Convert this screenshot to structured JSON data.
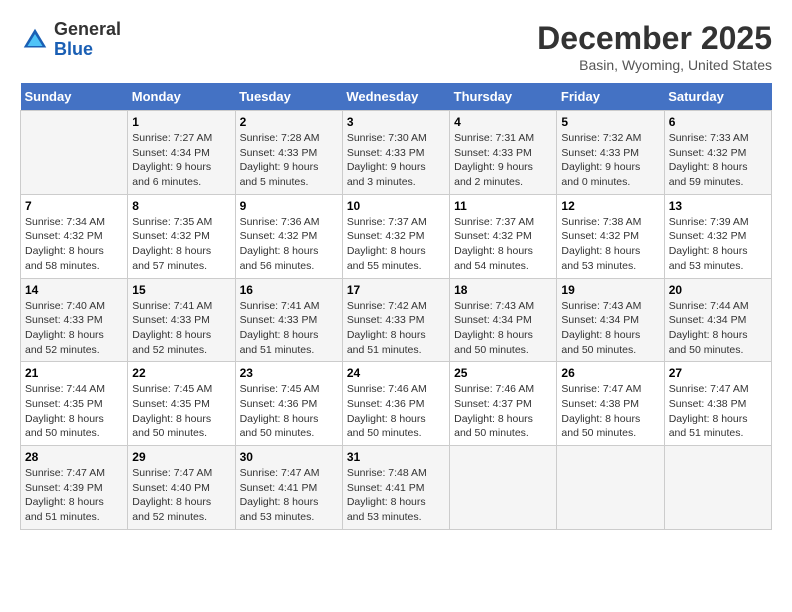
{
  "header": {
    "logo": {
      "general": "General",
      "blue": "Blue"
    },
    "title": "December 2025",
    "location": "Basin, Wyoming, United States"
  },
  "calendar": {
    "days_of_week": [
      "Sunday",
      "Monday",
      "Tuesday",
      "Wednesday",
      "Thursday",
      "Friday",
      "Saturday"
    ],
    "weeks": [
      [
        {
          "day": "",
          "info": ""
        },
        {
          "day": "1",
          "info": "Sunrise: 7:27 AM\nSunset: 4:34 PM\nDaylight: 9 hours\nand 6 minutes."
        },
        {
          "day": "2",
          "info": "Sunrise: 7:28 AM\nSunset: 4:33 PM\nDaylight: 9 hours\nand 5 minutes."
        },
        {
          "day": "3",
          "info": "Sunrise: 7:30 AM\nSunset: 4:33 PM\nDaylight: 9 hours\nand 3 minutes."
        },
        {
          "day": "4",
          "info": "Sunrise: 7:31 AM\nSunset: 4:33 PM\nDaylight: 9 hours\nand 2 minutes."
        },
        {
          "day": "5",
          "info": "Sunrise: 7:32 AM\nSunset: 4:33 PM\nDaylight: 9 hours\nand 0 minutes."
        },
        {
          "day": "6",
          "info": "Sunrise: 7:33 AM\nSunset: 4:32 PM\nDaylight: 8 hours\nand 59 minutes."
        }
      ],
      [
        {
          "day": "7",
          "info": "Sunrise: 7:34 AM\nSunset: 4:32 PM\nDaylight: 8 hours\nand 58 minutes."
        },
        {
          "day": "8",
          "info": "Sunrise: 7:35 AM\nSunset: 4:32 PM\nDaylight: 8 hours\nand 57 minutes."
        },
        {
          "day": "9",
          "info": "Sunrise: 7:36 AM\nSunset: 4:32 PM\nDaylight: 8 hours\nand 56 minutes."
        },
        {
          "day": "10",
          "info": "Sunrise: 7:37 AM\nSunset: 4:32 PM\nDaylight: 8 hours\nand 55 minutes."
        },
        {
          "day": "11",
          "info": "Sunrise: 7:37 AM\nSunset: 4:32 PM\nDaylight: 8 hours\nand 54 minutes."
        },
        {
          "day": "12",
          "info": "Sunrise: 7:38 AM\nSunset: 4:32 PM\nDaylight: 8 hours\nand 53 minutes."
        },
        {
          "day": "13",
          "info": "Sunrise: 7:39 AM\nSunset: 4:32 PM\nDaylight: 8 hours\nand 53 minutes."
        }
      ],
      [
        {
          "day": "14",
          "info": "Sunrise: 7:40 AM\nSunset: 4:33 PM\nDaylight: 8 hours\nand 52 minutes."
        },
        {
          "day": "15",
          "info": "Sunrise: 7:41 AM\nSunset: 4:33 PM\nDaylight: 8 hours\nand 52 minutes."
        },
        {
          "day": "16",
          "info": "Sunrise: 7:41 AM\nSunset: 4:33 PM\nDaylight: 8 hours\nand 51 minutes."
        },
        {
          "day": "17",
          "info": "Sunrise: 7:42 AM\nSunset: 4:33 PM\nDaylight: 8 hours\nand 51 minutes."
        },
        {
          "day": "18",
          "info": "Sunrise: 7:43 AM\nSunset: 4:34 PM\nDaylight: 8 hours\nand 50 minutes."
        },
        {
          "day": "19",
          "info": "Sunrise: 7:43 AM\nSunset: 4:34 PM\nDaylight: 8 hours\nand 50 minutes."
        },
        {
          "day": "20",
          "info": "Sunrise: 7:44 AM\nSunset: 4:34 PM\nDaylight: 8 hours\nand 50 minutes."
        }
      ],
      [
        {
          "day": "21",
          "info": "Sunrise: 7:44 AM\nSunset: 4:35 PM\nDaylight: 8 hours\nand 50 minutes."
        },
        {
          "day": "22",
          "info": "Sunrise: 7:45 AM\nSunset: 4:35 PM\nDaylight: 8 hours\nand 50 minutes."
        },
        {
          "day": "23",
          "info": "Sunrise: 7:45 AM\nSunset: 4:36 PM\nDaylight: 8 hours\nand 50 minutes."
        },
        {
          "day": "24",
          "info": "Sunrise: 7:46 AM\nSunset: 4:36 PM\nDaylight: 8 hours\nand 50 minutes."
        },
        {
          "day": "25",
          "info": "Sunrise: 7:46 AM\nSunset: 4:37 PM\nDaylight: 8 hours\nand 50 minutes."
        },
        {
          "day": "26",
          "info": "Sunrise: 7:47 AM\nSunset: 4:38 PM\nDaylight: 8 hours\nand 50 minutes."
        },
        {
          "day": "27",
          "info": "Sunrise: 7:47 AM\nSunset: 4:38 PM\nDaylight: 8 hours\nand 51 minutes."
        }
      ],
      [
        {
          "day": "28",
          "info": "Sunrise: 7:47 AM\nSunset: 4:39 PM\nDaylight: 8 hours\nand 51 minutes."
        },
        {
          "day": "29",
          "info": "Sunrise: 7:47 AM\nSunset: 4:40 PM\nDaylight: 8 hours\nand 52 minutes."
        },
        {
          "day": "30",
          "info": "Sunrise: 7:47 AM\nSunset: 4:41 PM\nDaylight: 8 hours\nand 53 minutes."
        },
        {
          "day": "31",
          "info": "Sunrise: 7:48 AM\nSunset: 4:41 PM\nDaylight: 8 hours\nand 53 minutes."
        },
        {
          "day": "",
          "info": ""
        },
        {
          "day": "",
          "info": ""
        },
        {
          "day": "",
          "info": ""
        }
      ]
    ]
  }
}
